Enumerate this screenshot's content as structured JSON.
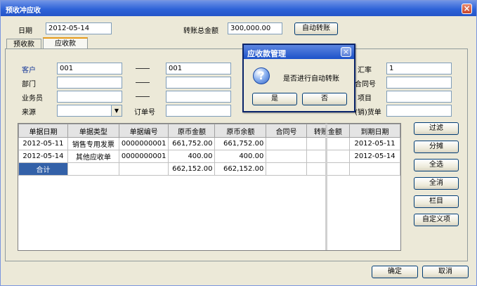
{
  "window": {
    "title": "预收冲应收",
    "close_glyph": "×"
  },
  "header": {
    "date_label": "日期",
    "date_value": "2012-05-14",
    "total_label": "转账总金额",
    "total_value": "300,000.00",
    "auto_button": "自动转账"
  },
  "tabs": [
    {
      "label": "预收款",
      "active": false
    },
    {
      "label": "应收款",
      "active": true
    }
  ],
  "form": {
    "customer_label": "客户",
    "customer_from": "001",
    "customer_to": "001",
    "dept_label": "部门",
    "salesman_label": "业务员",
    "source_label": "来源",
    "order_label": "订单号",
    "rate_label": "汇率",
    "rate_value": "1",
    "contract_label": "合同号",
    "project_label": "项目",
    "invoice_label": "(销)货单"
  },
  "table": {
    "columns": [
      "单据日期",
      "单据类型",
      "单据编号",
      "原币金额",
      "原币余额",
      "合同号",
      "转账金额",
      "到期日期"
    ],
    "rows": [
      [
        "2012-05-11",
        "销售专用发票",
        "0000000001",
        "661,752.00",
        "661,752.00",
        "",
        "",
        "2012-05-11"
      ],
      [
        "2012-05-14",
        "其他应收单",
        "0000000001",
        "400.00",
        "400.00",
        "",
        "",
        "2012-05-14"
      ]
    ],
    "total": {
      "label": "合计",
      "amount": "662,152.00",
      "balance": "662,152.00"
    }
  },
  "side_buttons": [
    "过滤",
    "分摊",
    "全选",
    "全消",
    "栏目",
    "自定义项"
  ],
  "footer": {
    "ok": "确定",
    "cancel": "取消"
  },
  "dialog": {
    "title": "应收款管理",
    "message": "是否进行自动转账",
    "yes": "是",
    "no": "否",
    "icon": "question-icon",
    "close_glyph": "×"
  },
  "colors": {
    "title_bar": "#2f63d8",
    "total_cell": "#3361a8",
    "label_blue": "#1a3c9a"
  }
}
